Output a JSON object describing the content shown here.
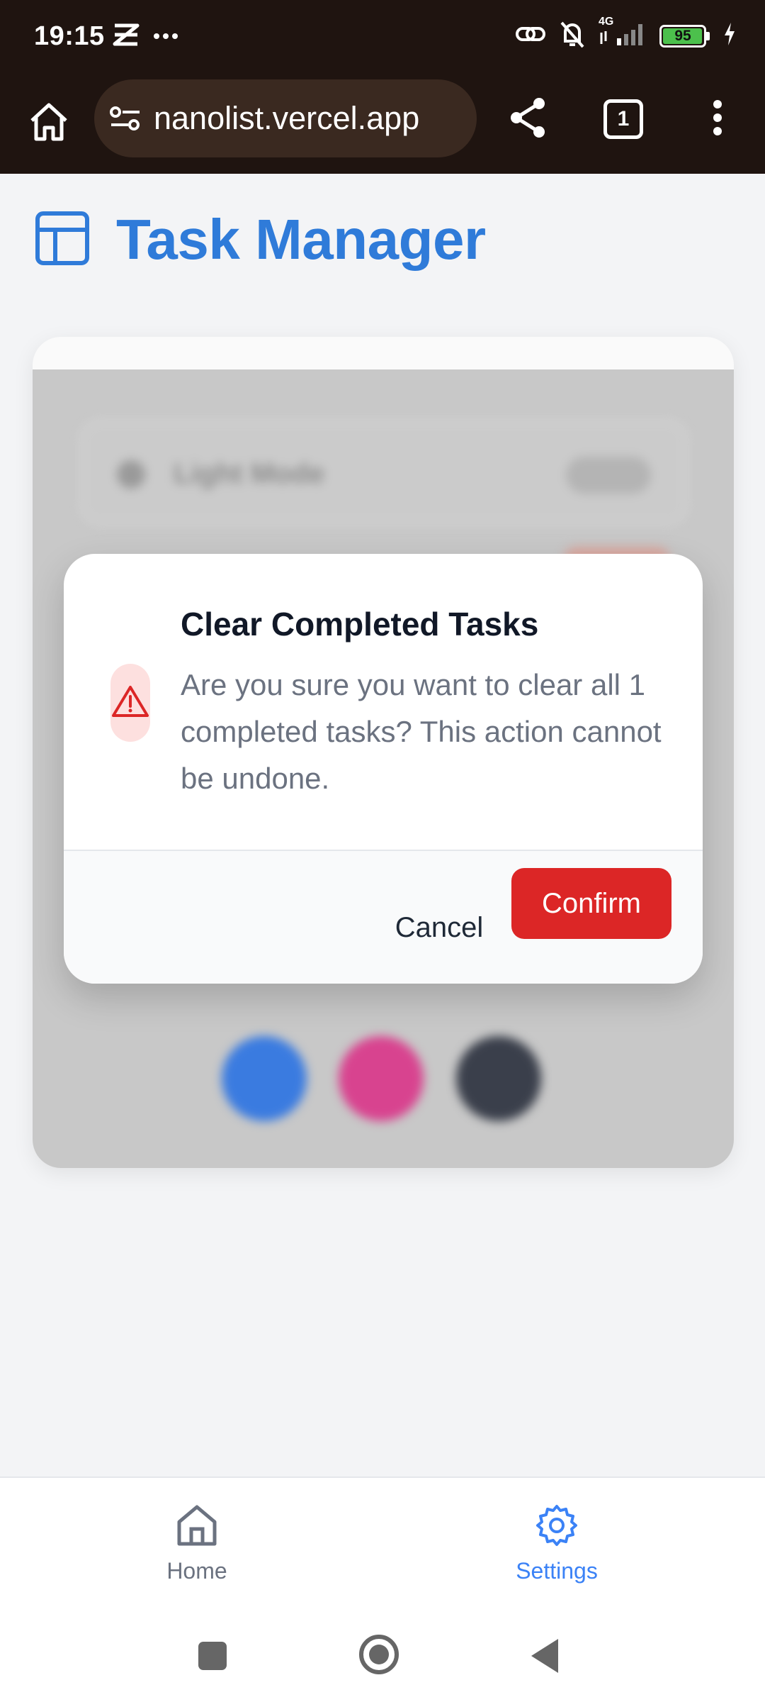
{
  "status_bar": {
    "time": "19:15",
    "network_type": "4G",
    "battery_level": "95",
    "icons": [
      "notification-app-icon",
      "more-dots-icon",
      "link-icon",
      "bell-off-icon",
      "signal-icon",
      "battery-icon",
      "charging-icon"
    ]
  },
  "browser": {
    "url": "nanolist.vercel.app",
    "tab_count": "1",
    "icons": [
      "home-icon",
      "site-settings-icon",
      "share-icon",
      "tabs-icon",
      "overflow-menu-icon"
    ]
  },
  "app": {
    "title": "Task Manager",
    "accent_color": "#2f7bd9"
  },
  "settings_background": {
    "theme_row_label": "Light Mode",
    "swatch_colors": [
      "#3a7be0",
      "#d8438f",
      "#3a3f4b"
    ]
  },
  "dialog": {
    "title": "Clear Completed Tasks",
    "message": "Are you sure you want to clear all 1 completed tasks? This action cannot be undone.",
    "cancel_label": "Cancel",
    "confirm_label": "Confirm",
    "confirm_color": "#dc2626"
  },
  "bottom_nav": {
    "items": [
      {
        "label": "Home",
        "icon": "home-icon",
        "active": false
      },
      {
        "label": "Settings",
        "icon": "gear-icon",
        "active": true
      }
    ]
  }
}
